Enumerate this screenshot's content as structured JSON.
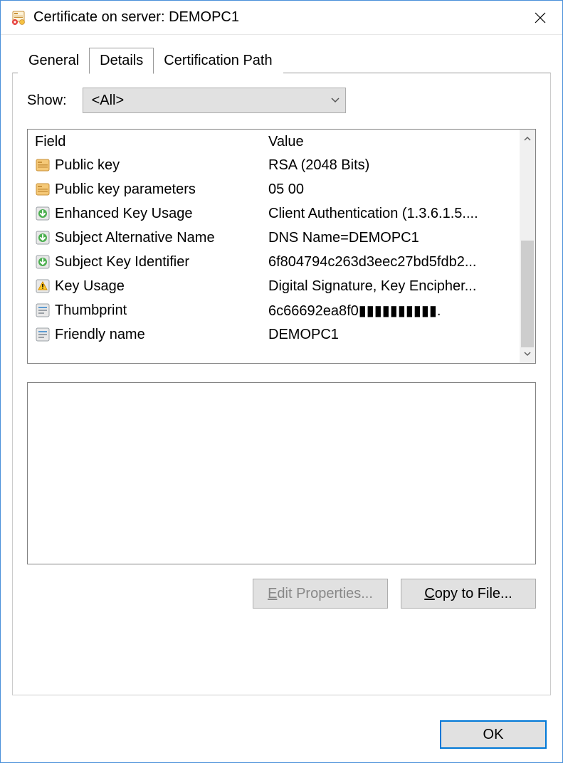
{
  "window": {
    "title": "Certificate on server: DEMOPC1"
  },
  "tabs": {
    "general": "General",
    "details": "Details",
    "certpath": "Certification Path",
    "active": "details"
  },
  "show": {
    "label": "Show:",
    "value": "<All>"
  },
  "columns": {
    "field": "Field",
    "value": "Value"
  },
  "fields": [
    {
      "icon": "cert-orange",
      "field": "Public key",
      "value": "RSA (2048 Bits)"
    },
    {
      "icon": "cert-orange",
      "field": "Public key parameters",
      "value": "05 00"
    },
    {
      "icon": "ext-green",
      "field": "Enhanced Key Usage",
      "value": "Client Authentication (1.3.6.1.5...."
    },
    {
      "icon": "ext-green",
      "field": "Subject Alternative Name",
      "value": "DNS Name=DEMOPC1"
    },
    {
      "icon": "ext-green",
      "field": "Subject Key Identifier",
      "value": "6f804794c263d3eec27bd5fdb2..."
    },
    {
      "icon": "ext-warn",
      "field": "Key Usage",
      "value": "Digital Signature, Key Encipher..."
    },
    {
      "icon": "prop",
      "field": "Thumbprint",
      "value": "6c66692ea8f0▮▮▮▮▮▮▮▮▮▮."
    },
    {
      "icon": "prop",
      "field": "Friendly name",
      "value": "DEMOPC1"
    }
  ],
  "buttons": {
    "edit_properties": "Edit Properties...",
    "copy_to_file": "Copy to File...",
    "ok": "OK"
  }
}
